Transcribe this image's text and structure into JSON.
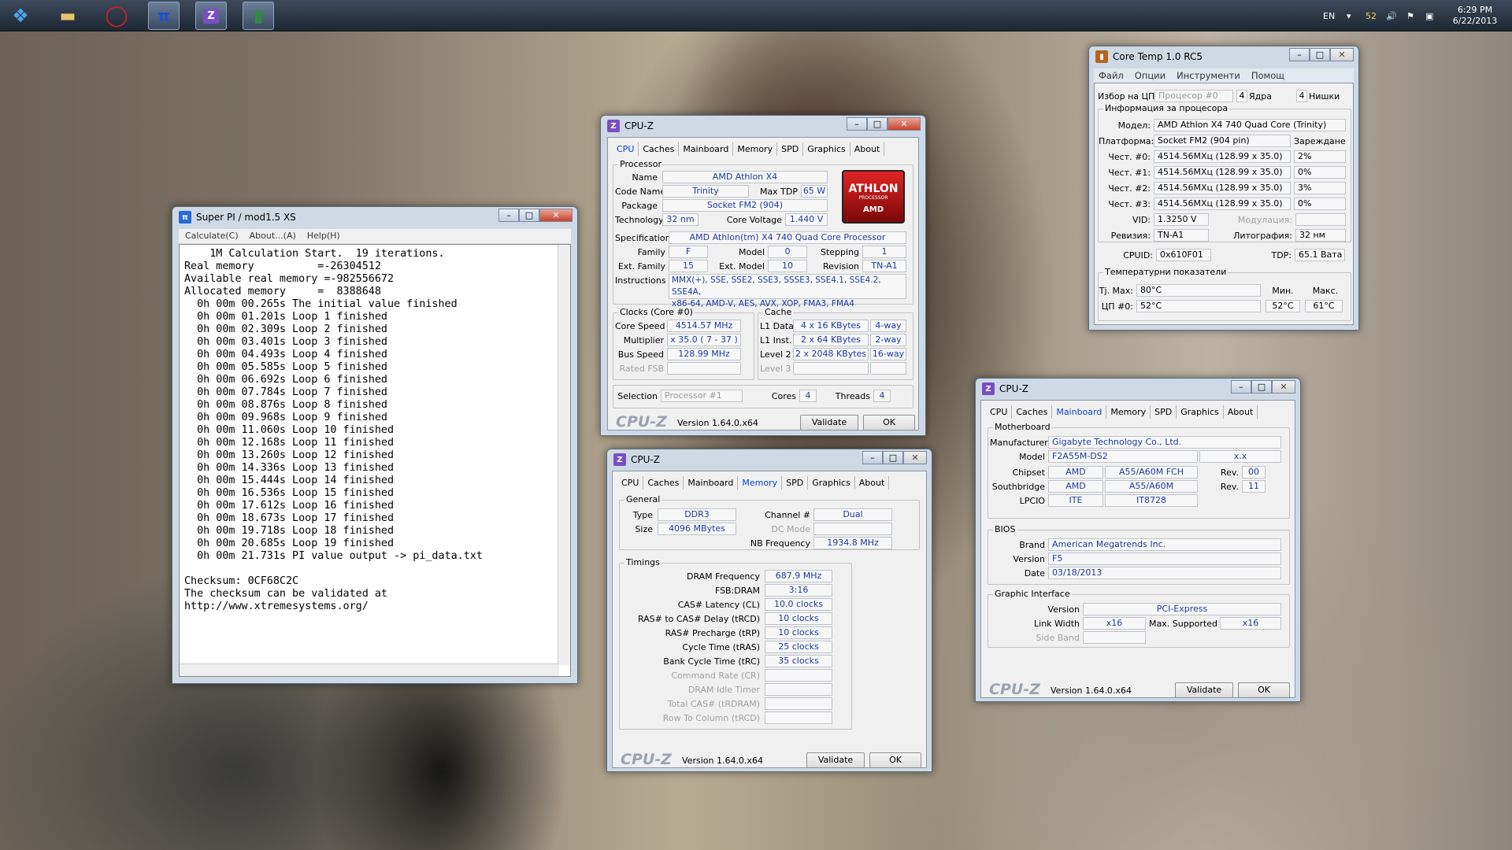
{
  "taskbar": {
    "icons": [
      {
        "name": "start-orb-icon",
        "glyph": "⊞",
        "color": "#4aa3e6"
      },
      {
        "name": "explorer-icon",
        "glyph": "▭",
        "color": "#e9c46a"
      },
      {
        "name": "opera-icon",
        "glyph": "O",
        "color": "#d21f1f"
      },
      {
        "name": "superpi-icon",
        "glyph": "π",
        "color": "#2255cc"
      },
      {
        "name": "cpuz-icon",
        "glyph": "Z",
        "color": "#7a4fc0"
      },
      {
        "name": "coretemp-icon",
        "glyph": "▮",
        "color": "#2e8b3e"
      }
    ],
    "tray": {
      "lang": "EN",
      "temp": "52",
      "time": "6:29 PM",
      "date": "6/22/2013"
    }
  },
  "superpi": {
    "title": "Super PI / mod1.5 XS",
    "menu": [
      "Calculate(C)",
      "About...(A)",
      "Help(H)"
    ],
    "lines": [
      "    1M Calculation Start.  19 iterations.",
      "Real memory          =-26304512",
      "Available real memory =-982556672",
      "Allocated memory     =  8388648",
      "  0h 00m 00.265s The initial value finished",
      "  0h 00m 01.201s Loop 1 finished",
      "  0h 00m 02.309s Loop 2 finished",
      "  0h 00m 03.401s Loop 3 finished",
      "  0h 00m 04.493s Loop 4 finished",
      "  0h 00m 05.585s Loop 5 finished",
      "  0h 00m 06.692s Loop 6 finished",
      "  0h 00m 07.784s Loop 7 finished",
      "  0h 00m 08.876s Loop 8 finished",
      "  0h 00m 09.968s Loop 9 finished",
      "  0h 00m 11.060s Loop 10 finished",
      "  0h 00m 12.168s Loop 11 finished",
      "  0h 00m 13.260s Loop 12 finished",
      "  0h 00m 14.336s Loop 13 finished",
      "  0h 00m 15.444s Loop 14 finished",
      "  0h 00m 16.536s Loop 15 finished",
      "  0h 00m 17.612s Loop 16 finished",
      "  0h 00m 18.673s Loop 17 finished",
      "  0h 00m 19.718s Loop 18 finished",
      "  0h 00m 20.685s Loop 19 finished",
      "  0h 00m 21.731s PI value output -> pi_data.txt",
      "",
      "Checksum: 0CF68C2C",
      "The checksum can be validated at",
      "http://www.xtremesystems.org/"
    ]
  },
  "cpuz_common": {
    "title": "CPU-Z",
    "logo": "CPU-Z",
    "version": "Version 1.64.0.x64",
    "validate": "Validate",
    "ok": "OK",
    "tabs": [
      "CPU",
      "Caches",
      "Mainboard",
      "Memory",
      "SPD",
      "Graphics",
      "About"
    ]
  },
  "cpu": {
    "processor_title": "Processor",
    "name_lbl": "Name",
    "name": "AMD Athlon X4",
    "codename_lbl": "Code Name",
    "codename": "Trinity",
    "maxtdp_lbl": "Max TDP",
    "maxtdp": "65 W",
    "package_lbl": "Package",
    "package": "Socket FM2 (904)",
    "tech_lbl": "Technology",
    "tech": "32 nm",
    "cv_lbl": "Core Voltage",
    "cv": "1.440 V",
    "spec_lbl": "Specification",
    "spec": "AMD Athlon(tm) X4 740 Quad Core Processor",
    "family_lbl": "Family",
    "family": "F",
    "model_lbl": "Model",
    "model": "0",
    "stepping_lbl": "Stepping",
    "stepping": "1",
    "extfam_lbl": "Ext. Family",
    "extfam": "15",
    "extmod_lbl": "Ext. Model",
    "extmod": "10",
    "rev_lbl": "Revision",
    "rev": "TN-A1",
    "instr_lbl": "Instructions",
    "instr1": "MMX(+), SSE, SSE2, SSE3, SSSE3, SSE4.1, SSE4.2, SSE4A,",
    "instr2": "x86-64, AMD-V, AES, AVX, XOP, FMA3, FMA4",
    "logo_top": "ATHLON",
    "logo_sub": "PROCESSOR",
    "logo_brand": "AMD",
    "clocks_title": "Clocks (Core #0)",
    "cs_lbl": "Core Speed",
    "cs": "4514.57 MHz",
    "mult_lbl": "Multiplier",
    "mult": "x 35.0 ( 7 - 37 )",
    "bus_lbl": "Bus Speed",
    "bus": "128.99 MHz",
    "fsb_lbl": "Rated FSB",
    "cache_title": "Cache",
    "l1d_lbl": "L1 Data",
    "l1d": "4 x 16 KBytes",
    "l1d_w": "4-way",
    "l1i_lbl": "L1 Inst.",
    "l1i": "2 x 64 KBytes",
    "l1i_w": "2-way",
    "l2_lbl": "Level 2",
    "l2": "2 x 2048 KBytes",
    "l2_w": "16-way",
    "l3_lbl": "Level 3",
    "sel_lbl": "Selection",
    "sel": "Processor #1",
    "cores_lbl": "Cores",
    "cores": "4",
    "threads_lbl": "Threads",
    "threads": "4"
  },
  "mem": {
    "general": "General",
    "type_lbl": "Type",
    "type": "DDR3",
    "size_lbl": "Size",
    "size": "4096 MBytes",
    "ch_lbl": "Channel #",
    "ch": "Dual",
    "dc_lbl": "DC Mode",
    "nb_lbl": "NB Frequency",
    "nb": "1934.8 MHz",
    "timings": "Timings",
    "rows": [
      {
        "l": "DRAM Frequency",
        "v": "687.9 MHz",
        "dim": false
      },
      {
        "l": "FSB:DRAM",
        "v": "3:16",
        "dim": false
      },
      {
        "l": "CAS# Latency (CL)",
        "v": "10.0 clocks",
        "dim": false
      },
      {
        "l": "RAS# to CAS# Delay (tRCD)",
        "v": "10 clocks",
        "dim": false
      },
      {
        "l": "RAS# Precharge (tRP)",
        "v": "10 clocks",
        "dim": false
      },
      {
        "l": "Cycle Time (tRAS)",
        "v": "25 clocks",
        "dim": false
      },
      {
        "l": "Bank Cycle Time (tRC)",
        "v": "35 clocks",
        "dim": false
      },
      {
        "l": "Command Rate (CR)",
        "v": "",
        "dim": true
      },
      {
        "l": "DRAM Idle Timer",
        "v": "",
        "dim": true
      },
      {
        "l": "Total CAS# (tRDRAM)",
        "v": "",
        "dim": true
      },
      {
        "l": "Row To Column (tRCD)",
        "v": "",
        "dim": true
      }
    ]
  },
  "mb": {
    "motherboard": "Motherboard",
    "manu_lbl": "Manufacturer",
    "manu": "Gigabyte Technology Co., Ltd.",
    "model_lbl": "Model",
    "model": "F2A55M-DS2",
    "model2": "x.x",
    "chip_lbl": "Chipset",
    "chip1": "AMD",
    "chip2": "A55/A60M FCH",
    "chiprev_lbl": "Rev.",
    "chiprev": "00",
    "sb_lbl": "Southbridge",
    "sb1": "AMD",
    "sb2": "A55/A60M",
    "sbrev_lbl": "Rev.",
    "sbrev": "11",
    "lpcio_lbl": "LPCIO",
    "lpcio1": "ITE",
    "lpcio2": "IT8728",
    "bios": "BIOS",
    "brand_lbl": "Brand",
    "brand": "American Megatrends Inc.",
    "ver_lbl": "Version",
    "ver": "F5",
    "date_lbl": "Date",
    "date": "03/18/2013",
    "gi": "Graphic Interface",
    "giver_lbl": "Version",
    "giver": "PCI-Express",
    "lw_lbl": "Link Width",
    "lw": "x16",
    "ms_lbl": "Max. Supported",
    "ms": "x16",
    "sbd_lbl": "Side Band"
  },
  "coretemp": {
    "title": "Core Temp 1.0 RC5",
    "menu": [
      "Файл",
      "Опции",
      "Инструменти",
      "Помощ"
    ],
    "sel_lbl": "Избор на ЦП:",
    "sel": "Процесор #0",
    "cores": "4",
    "cores_lbl": "Ядра",
    "threads": "4",
    "threads_lbl": "Нишки",
    "info": "Информация за процесора",
    "model_lbl": "Модел:",
    "model": "AMD Athlon X4 740 Quad Core (Trinity)",
    "plat_lbl": "Платформа:",
    "plat": "Socket FM2 (904 pin)",
    "load_lbl": "Зареждане",
    "freqs": [
      {
        "l": "Чест. #0:",
        "v": "4514.56МХц (128.99 x 35.0)",
        "p": "2%"
      },
      {
        "l": "Чест. #1:",
        "v": "4514.56МХц (128.99 x 35.0)",
        "p": "0%"
      },
      {
        "l": "Чест. #2:",
        "v": "4514.56МХц (128.99 x 35.0)",
        "p": "3%"
      },
      {
        "l": "Чест. #3:",
        "v": "4514.56МХц (128.99 x 35.0)",
        "p": "0%"
      }
    ],
    "vid_lbl": "VID:",
    "vid": "1.3250 V",
    "mod_lbl": "Модулация:",
    "rev_lbl": "Ревизия:",
    "rev": "TN-A1",
    "lith_lbl": "Литография:",
    "lith": "32 нм",
    "cpuid_lbl": "CPUID:",
    "cpuid": "0x610F01",
    "tdp_lbl": "TDP:",
    "tdp": "65.1 Вата",
    "temps": "Температурни показатели",
    "tj_lbl": "Tj. Max:",
    "tj": "80°C",
    "min_lbl": "Мин.",
    "max_lbl": "Макс.",
    "c0_lbl": "ЦП #0:",
    "c0": "52°C",
    "c0min": "52°C",
    "c0max": "61°C"
  }
}
